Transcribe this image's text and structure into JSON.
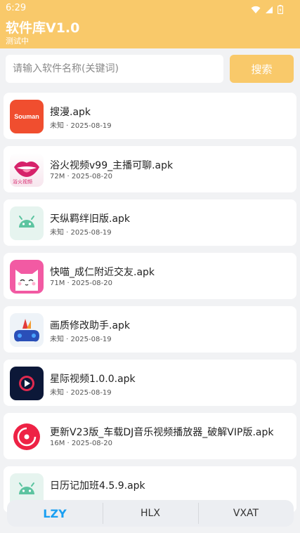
{
  "status_bar": {
    "time": "6:29"
  },
  "header": {
    "title": "软件库V1.0",
    "subtitle": "测试中"
  },
  "search": {
    "placeholder": "请输入软件名称(关键词)",
    "button_label": "搜索"
  },
  "colors": {
    "accent": "#f9c96a",
    "active_tab": "#1a9ff2"
  },
  "apps": [
    {
      "name": "搜漫.apk",
      "meta": "未知 · 2025-08-19",
      "icon": "souman-logo-icon",
      "icon_text": "Souman"
    },
    {
      "name": "浴火视频v99_主播可聊.apk",
      "meta": "72M · 2025-08-20",
      "icon": "lips-icon",
      "icon_text": "浴火视频"
    },
    {
      "name": "天纵羁绊旧版.apk",
      "meta": "未知 · 2025-08-19",
      "icon": "android-icon"
    },
    {
      "name": "快喵_成仁附近交友.apk",
      "meta": "71M · 2025-08-20",
      "icon": "cat-icon"
    },
    {
      "name": "画质修改助手.apk",
      "meta": "未知 · 2025-08-19",
      "icon": "gamepad-icon"
    },
    {
      "name": "星际视频1.0.0.apk",
      "meta": "未知 · 2025-08-19",
      "icon": "play-icon"
    },
    {
      "name": "更新V23版_车载DJ音乐视频播放器_破解VIP版.apk",
      "meta": "16M · 2025-08-20",
      "icon": "music-disc-icon"
    },
    {
      "name": "日历记加班4.5.9.apk",
      "meta": "",
      "icon": "android-icon"
    }
  ],
  "nav": {
    "tabs": [
      "LZY",
      "HLX",
      "VXAT"
    ],
    "active": "LZY"
  }
}
